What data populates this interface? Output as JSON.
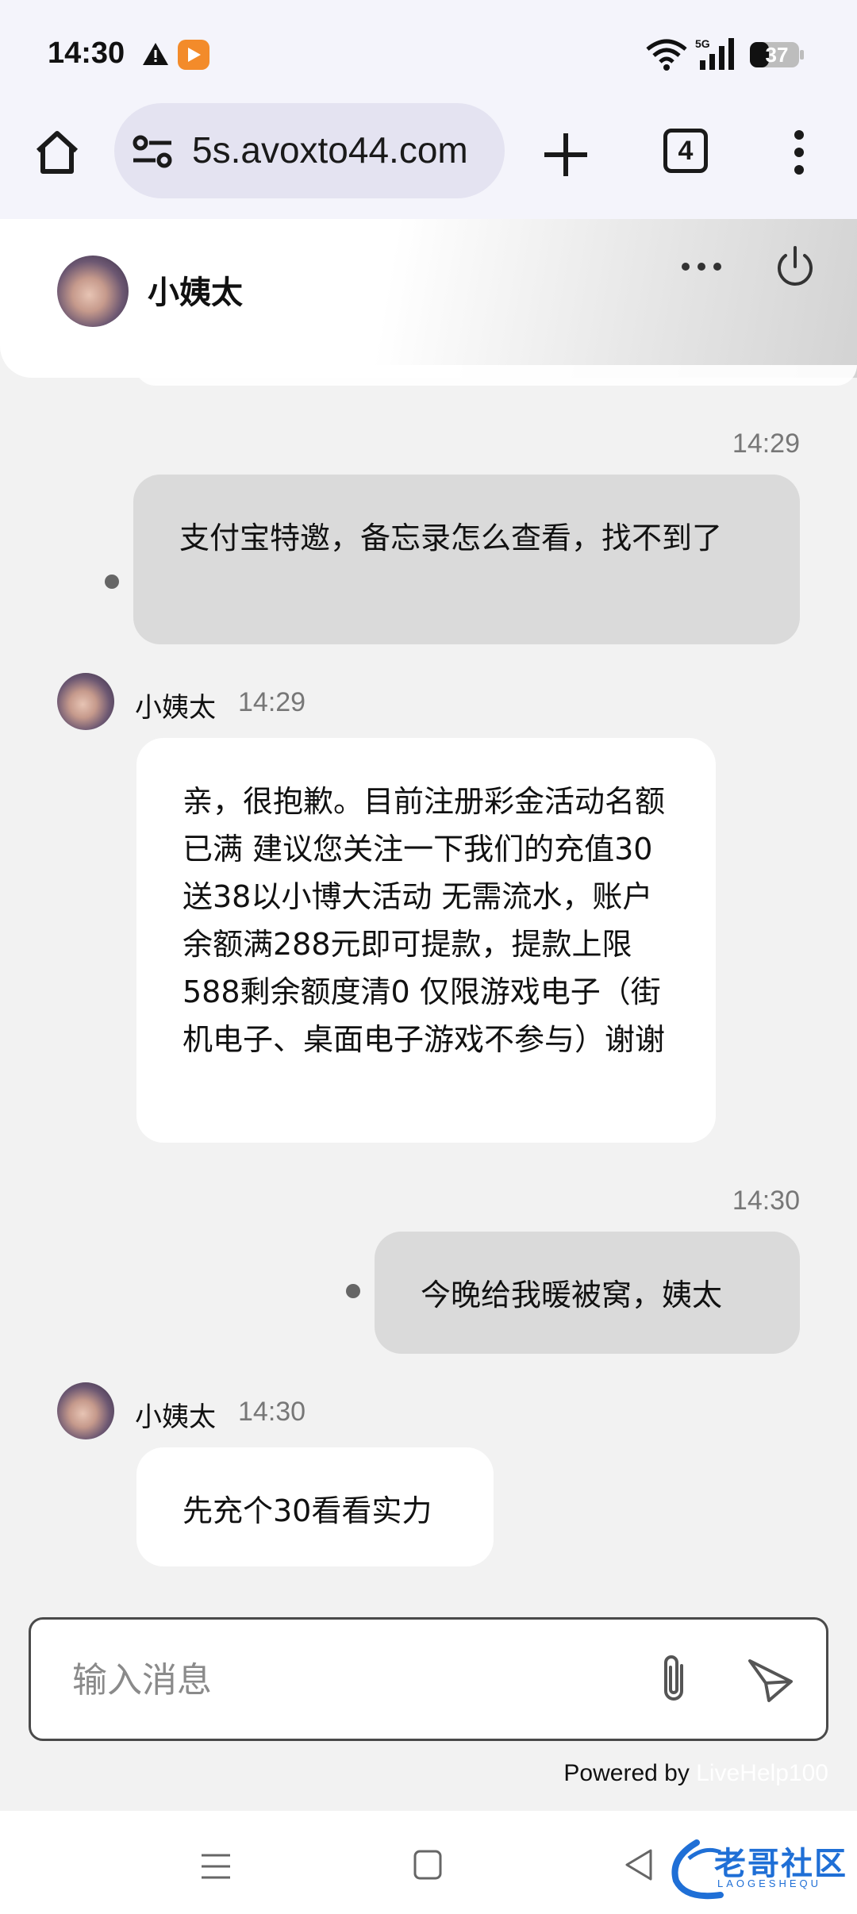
{
  "status_bar": {
    "time": "14:30",
    "network": "5G",
    "battery": "37"
  },
  "browser": {
    "url": "5s.avoxto44.com",
    "tab_count": "4"
  },
  "chat": {
    "agent_name": "小姨太",
    "messages": [
      {
        "direction": "out",
        "time": "14:29",
        "text": "支付宝特邀，备忘录怎么查看，找不到了"
      },
      {
        "direction": "in",
        "sender": "小姨太",
        "time": "14:29",
        "text": "亲，很抱歉。目前注册彩金活动名额已满 建议您关注一下我们的充值30送38以小博大活动 无需流水，账户余额满288元即可提款，提款上限588剩余额度清0 仅限游戏电子（街机电子、桌面电子游戏不参与）谢谢"
      },
      {
        "direction": "out",
        "time": "14:30",
        "text": "今晚给我暖被窝，姨太"
      },
      {
        "direction": "in",
        "sender": "小姨太",
        "time": "14:30",
        "text": "先充个30看看实力"
      }
    ]
  },
  "composer": {
    "placeholder": "输入消息"
  },
  "footer": {
    "powered_by": "Powered by",
    "brand": "LiveHelp100"
  },
  "watermark": {
    "text": "老哥社区",
    "sub": "LAOGESHEQU"
  },
  "colors": {
    "outgoing_bubble": "#dadada",
    "incoming_bubble": "#ffffff",
    "background": "#f2f2f2",
    "url_pill": "#e4e3f1",
    "watermark": "#1f6fd6"
  },
  "icons": [
    "warning-icon",
    "video-app-icon",
    "wifi-icon",
    "signal-icon",
    "battery-icon",
    "home-icon",
    "site-settings-icon",
    "new-tab-icon",
    "tab-switcher-icon",
    "more-menu-icon",
    "more-options-icon",
    "power-icon",
    "paperclip-icon",
    "send-icon",
    "recents-icon",
    "home-button-icon",
    "back-icon"
  ]
}
